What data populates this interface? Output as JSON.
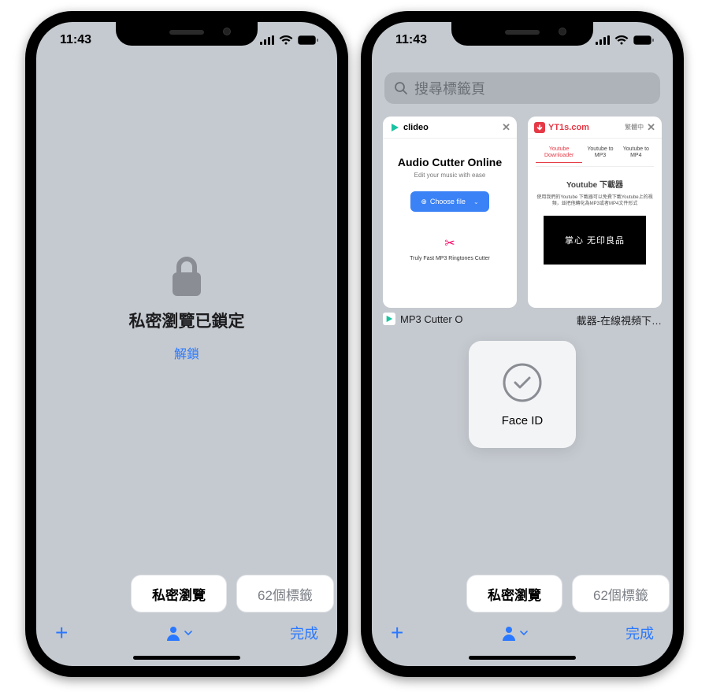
{
  "status": {
    "time": "11:43"
  },
  "colors": {
    "accent": "#2a78ff"
  },
  "phone1": {
    "locked_title": "私密瀏覽已鎖定",
    "unlock": "解鎖"
  },
  "seg": {
    "active": "私密瀏覽",
    "inactive": "62個標籤"
  },
  "toolbar": {
    "done": "完成"
  },
  "phone2": {
    "search_placeholder": "搜尋標籤頁",
    "faceid": "Face ID",
    "tabs": [
      {
        "site": "clideo",
        "headline": "Audio Cutter Online",
        "sub": "Edit your music with ease",
        "choose": "Choose file",
        "footer": "Truly Fast MP3 Ringtones Cutter",
        "title": "MP3 Cutter O"
      },
      {
        "site": "YT1s.com",
        "lang": "繁體中",
        "menu": [
          "Youtube Downloader",
          "Youtube to MP3",
          "Youtube to MP4"
        ],
        "headline": "Youtube 下載器",
        "desc": "使用我們的Youtube 下載器可以免費下載Youtube上的視頻，並把他轉化為MP3或者MP4文件形式",
        "thumb": "掌心 无印良品",
        "title": "載器-在線視頻下…"
      }
    ]
  }
}
